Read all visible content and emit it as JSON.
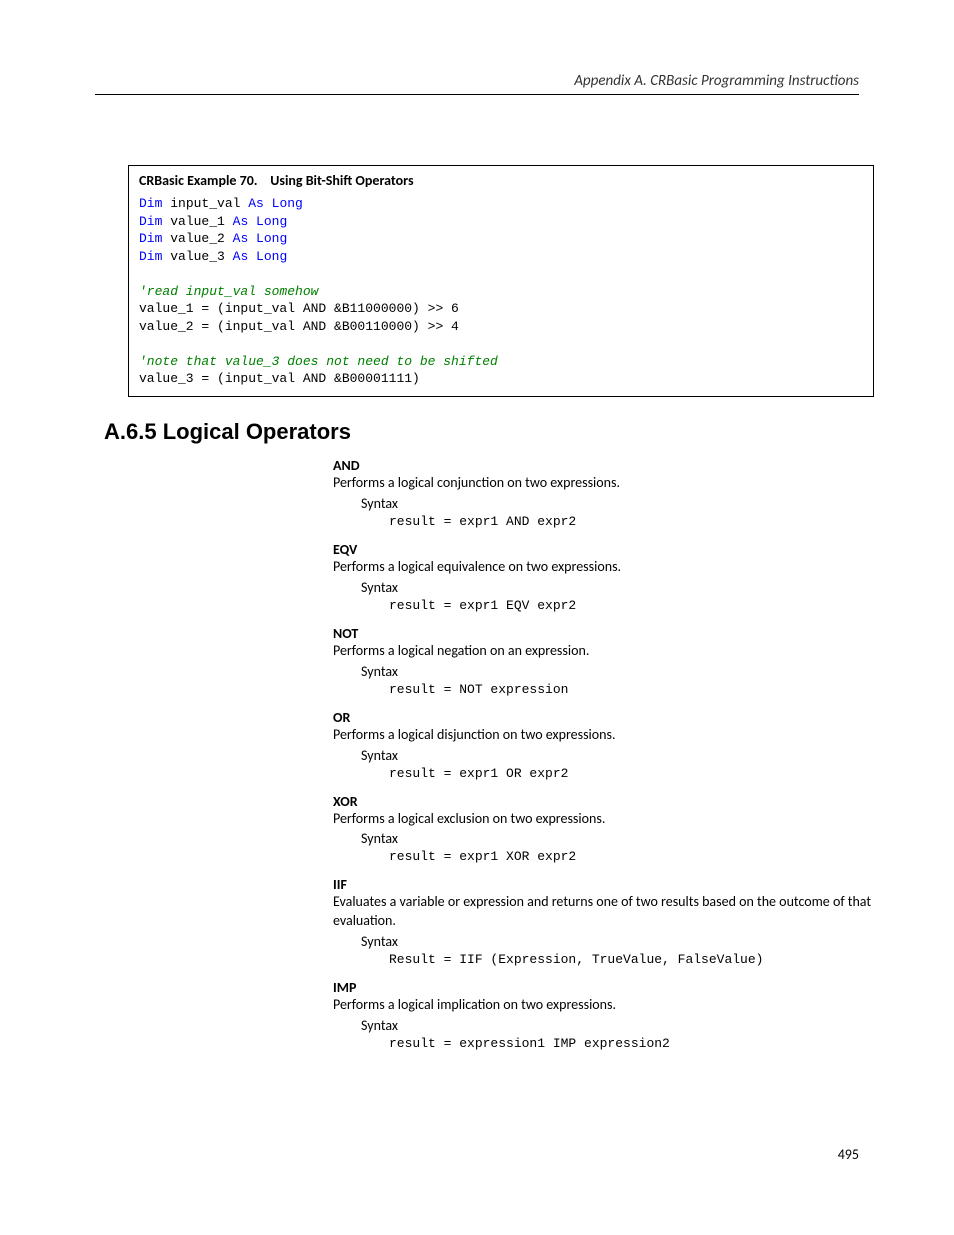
{
  "header": "Appendix A.  CRBasic Programming Instructions",
  "codebox": {
    "title_prefix": "CRBasic Example 70.",
    "title_suffix": "Using Bit-Shift Operators",
    "code": {
      "dim_kw": "Dim",
      "as_long": "As Long",
      "vars": [
        "input_val",
        "value_1",
        "value_2",
        "value_3"
      ],
      "comment1": "'read input_val somehow",
      "line1": "value_1 = (input_val AND &B11000000) >> 6",
      "line2": "value_2 = (input_val AND &B00110000) >> 4",
      "comment2": "'note that value_3 does not need to be shifted",
      "line3": "value_3 = (input_val AND &B00001111)"
    }
  },
  "section_heading": "A.6.5 Logical Operators",
  "syntax_label": "Syntax",
  "operators": [
    {
      "name": "AND",
      "desc": "Performs a logical conjunction on two expressions.",
      "syntax": "result = expr1 AND expr2"
    },
    {
      "name": "EQV",
      "desc": "Performs a logical equivalence on two expressions.",
      "syntax": "result = expr1 EQV expr2"
    },
    {
      "name": "NOT",
      "desc": "Performs a logical negation on an expression.",
      "syntax": "result = NOT expression"
    },
    {
      "name": "OR",
      "desc": "Performs a logical disjunction on two expressions.",
      "syntax": "result = expr1 OR expr2"
    },
    {
      "name": "XOR",
      "desc": "Performs a logical exclusion on two expressions.",
      "syntax": "result = expr1 XOR expr2"
    },
    {
      "name": "IIF",
      "desc": "Evaluates a variable or expression and returns one of two results based on the outcome of that evaluation.",
      "syntax": "Result = IIF (Expression, TrueValue, FalseValue)"
    },
    {
      "name": "IMP",
      "desc": "Performs a logical implication on two expressions.",
      "syntax": "result = expression1 IMP expression2"
    }
  ],
  "page_number": "495"
}
